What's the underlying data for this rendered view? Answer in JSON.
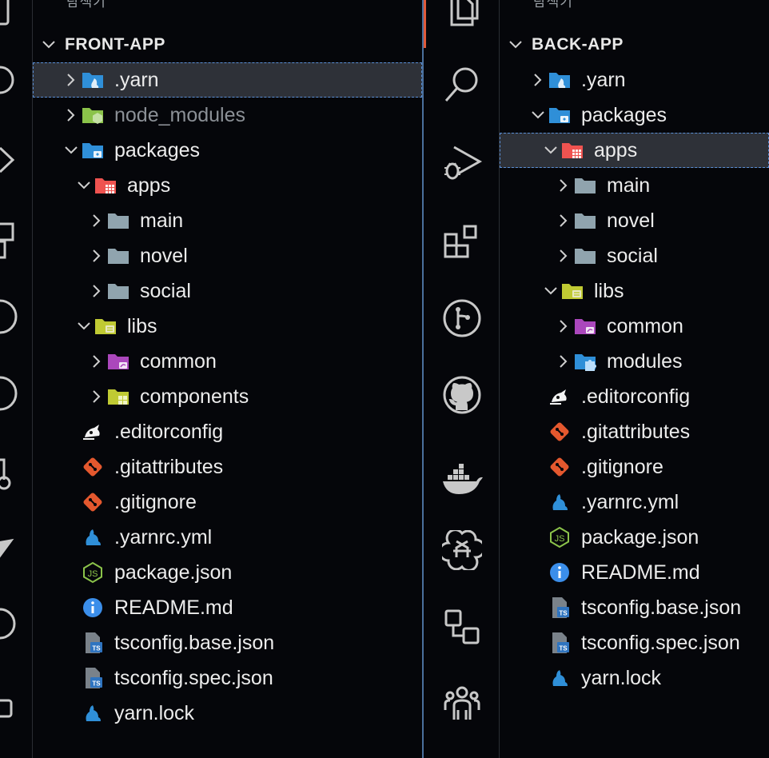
{
  "left": {
    "explorer_title": "탐색기",
    "more": "···",
    "section_title": "FRONT-APP",
    "rows": [
      {
        "label": ".yarn",
        "depth": 0,
        "twisty": "closed",
        "icon": "yarn-folder",
        "selected": true
      },
      {
        "label": "node_modules",
        "depth": 0,
        "twisty": "closed",
        "icon": "node-folder",
        "dim": true
      },
      {
        "label": "packages",
        "depth": 0,
        "twisty": "open",
        "icon": "packages-folder"
      },
      {
        "label": "apps",
        "depth": 1,
        "twisty": "open",
        "icon": "apps-folder"
      },
      {
        "label": "main",
        "depth": 2,
        "twisty": "closed",
        "icon": "folder"
      },
      {
        "label": "novel",
        "depth": 2,
        "twisty": "closed",
        "icon": "folder"
      },
      {
        "label": "social",
        "depth": 2,
        "twisty": "closed",
        "icon": "folder"
      },
      {
        "label": "libs",
        "depth": 1,
        "twisty": "open",
        "icon": "libs-folder"
      },
      {
        "label": "common",
        "depth": 2,
        "twisty": "closed",
        "icon": "common-folder"
      },
      {
        "label": "components",
        "depth": 2,
        "twisty": "closed",
        "icon": "components-folder"
      },
      {
        "label": ".editorconfig",
        "depth": 0,
        "twisty": "none",
        "icon": "editorconfig"
      },
      {
        "label": ".gitattributes",
        "depth": 0,
        "twisty": "none",
        "icon": "git"
      },
      {
        "label": ".gitignore",
        "depth": 0,
        "twisty": "none",
        "icon": "git"
      },
      {
        "label": ".yarnrc.yml",
        "depth": 0,
        "twisty": "none",
        "icon": "yarn"
      },
      {
        "label": "package.json",
        "depth": 0,
        "twisty": "none",
        "icon": "nodejs"
      },
      {
        "label": "README.md",
        "depth": 0,
        "twisty": "none",
        "icon": "info"
      },
      {
        "label": "tsconfig.base.json",
        "depth": 0,
        "twisty": "none",
        "icon": "tsconfig"
      },
      {
        "label": "tsconfig.spec.json",
        "depth": 0,
        "twisty": "none",
        "icon": "tsconfig"
      },
      {
        "label": "yarn.lock",
        "depth": 0,
        "twisty": "none",
        "icon": "yarn"
      }
    ]
  },
  "right": {
    "explorer_title": "탐색기",
    "more": "···",
    "section_title": "BACK-APP",
    "rows": [
      {
        "label": ".yarn",
        "depth": 0,
        "twisty": "closed",
        "icon": "yarn-folder"
      },
      {
        "label": "packages",
        "depth": 0,
        "twisty": "open",
        "icon": "packages-folder"
      },
      {
        "label": "apps",
        "depth": 1,
        "twisty": "open",
        "icon": "apps-folder",
        "selected": true
      },
      {
        "label": "main",
        "depth": 2,
        "twisty": "closed",
        "icon": "folder"
      },
      {
        "label": "novel",
        "depth": 2,
        "twisty": "closed",
        "icon": "folder"
      },
      {
        "label": "social",
        "depth": 2,
        "twisty": "closed",
        "icon": "folder"
      },
      {
        "label": "libs",
        "depth": 1,
        "twisty": "open",
        "icon": "libs-folder"
      },
      {
        "label": "common",
        "depth": 2,
        "twisty": "closed",
        "icon": "common-folder"
      },
      {
        "label": "modules",
        "depth": 2,
        "twisty": "closed",
        "icon": "modules-folder"
      },
      {
        "label": ".editorconfig",
        "depth": 0,
        "twisty": "none",
        "icon": "editorconfig"
      },
      {
        "label": ".gitattributes",
        "depth": 0,
        "twisty": "none",
        "icon": "git"
      },
      {
        "label": ".gitignore",
        "depth": 0,
        "twisty": "none",
        "icon": "git"
      },
      {
        "label": ".yarnrc.yml",
        "depth": 0,
        "twisty": "none",
        "icon": "yarn"
      },
      {
        "label": "package.json",
        "depth": 0,
        "twisty": "none",
        "icon": "nodejs"
      },
      {
        "label": "README.md",
        "depth": 0,
        "twisty": "none",
        "icon": "info"
      },
      {
        "label": "tsconfig.base.json",
        "depth": 0,
        "twisty": "none",
        "icon": "tsconfig"
      },
      {
        "label": "tsconfig.spec.json",
        "depth": 0,
        "twisty": "none",
        "icon": "tsconfig"
      },
      {
        "label": "yarn.lock",
        "depth": 0,
        "twisty": "none",
        "icon": "yarn"
      }
    ]
  },
  "activity_right": [
    {
      "name": "explorer-icon"
    },
    {
      "name": "search-icon"
    },
    {
      "name": "run-debug-icon"
    },
    {
      "name": "extensions-icon"
    },
    {
      "name": "source-control-icon"
    },
    {
      "name": "github-icon"
    },
    {
      "name": "docker-icon"
    },
    {
      "name": "openai-icon"
    },
    {
      "name": "remote-explorer-icon"
    },
    {
      "name": "live-share-icon"
    }
  ],
  "colors": {
    "background": "#05060a",
    "selection": "#2e3138",
    "focus_outline": "#5a8fd6",
    "active_indicator": "#e05a3a",
    "folder_gray": "#90a4ae",
    "yarn_blue": "#2f8fd8",
    "git_red": "#e4582e",
    "node_green": "#8bc34a",
    "libs_yellow": "#c0ca33",
    "common_purple": "#ab47bc",
    "apps_red": "#ef5350"
  }
}
